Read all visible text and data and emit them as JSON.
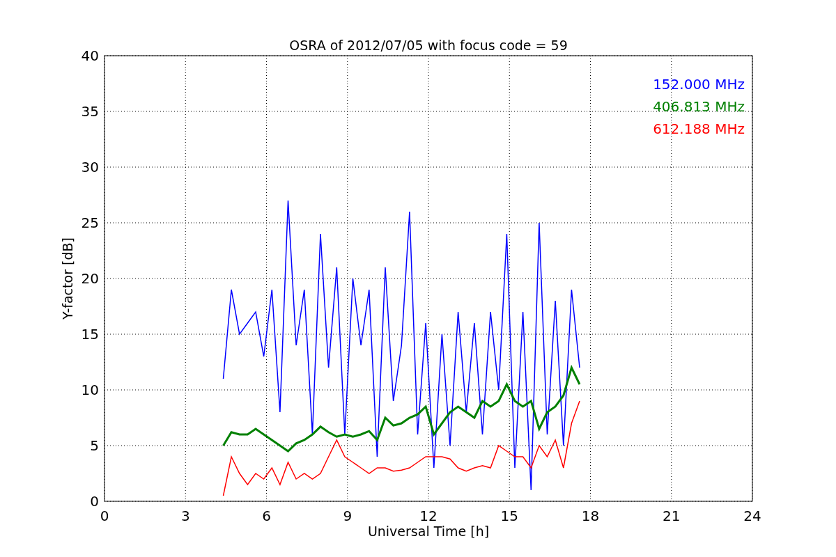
{
  "chart_data": {
    "type": "line",
    "title": "OSRA of 2012/07/05 with focus code = 59",
    "xlabel": "Universal Time [h]",
    "ylabel": "Y-factor [dB]",
    "x": [
      4.4,
      4.7,
      5.0,
      5.3,
      5.6,
      5.9,
      6.2,
      6.5,
      6.8,
      7.1,
      7.4,
      7.7,
      8.0,
      8.3,
      8.6,
      8.9,
      9.2,
      9.5,
      9.8,
      10.1,
      10.4,
      10.7,
      11.0,
      11.3,
      11.6,
      11.9,
      12.2,
      12.5,
      12.8,
      13.1,
      13.4,
      13.7,
      14.0,
      14.3,
      14.6,
      14.9,
      15.2,
      15.5,
      15.8,
      16.1,
      16.4,
      16.7,
      17.0,
      17.3,
      17.6
    ],
    "series": [
      {
        "name": "152.000 MHz",
        "color": "#0000ff",
        "values": [
          11,
          19,
          15,
          16,
          17,
          13,
          19,
          8,
          27,
          14,
          19,
          6,
          24,
          12,
          21,
          6,
          20,
          14,
          19,
          4,
          21,
          9,
          14,
          26,
          6,
          16,
          3,
          15,
          5,
          17,
          8,
          16,
          6,
          17,
          10,
          24,
          3,
          17,
          1,
          25,
          6,
          18,
          5,
          19,
          12
        ]
      },
      {
        "name": "406.813 MHz",
        "color": "#008000",
        "values": [
          5,
          6.2,
          6,
          6,
          6.5,
          6,
          5.5,
          5,
          4.5,
          5.2,
          5.5,
          6,
          6.7,
          6.2,
          5.8,
          6,
          5.8,
          6,
          6.3,
          5.5,
          7.5,
          6.8,
          7,
          7.5,
          7.8,
          8.5,
          6,
          7,
          8,
          8.5,
          8,
          7.5,
          9,
          8.5,
          9,
          10.5,
          9,
          8.5,
          9,
          6.5,
          8,
          8.5,
          9.5,
          12,
          10.5
        ]
      },
      {
        "name": "612.188 MHz",
        "color": "#ff0000",
        "values": [
          0.5,
          4,
          2.5,
          1.5,
          2.5,
          2,
          3,
          1.5,
          3.5,
          2,
          2.5,
          2,
          2.5,
          4,
          5.5,
          4,
          3.5,
          3,
          2.5,
          3,
          3,
          2.7,
          2.8,
          3,
          3.5,
          4,
          4,
          4,
          3.8,
          3,
          2.7,
          3,
          3.2,
          3,
          5,
          4.5,
          4,
          4,
          3,
          5,
          4,
          5.5,
          3,
          7,
          9
        ]
      }
    ],
    "grid": true,
    "xlim": [
      0,
      24
    ],
    "ylim": [
      0,
      40
    ],
    "xticks": [
      0,
      3,
      6,
      9,
      12,
      15,
      18,
      21,
      24
    ],
    "yticks": [
      0,
      5,
      10,
      15,
      20,
      25,
      30,
      35,
      40
    ]
  }
}
